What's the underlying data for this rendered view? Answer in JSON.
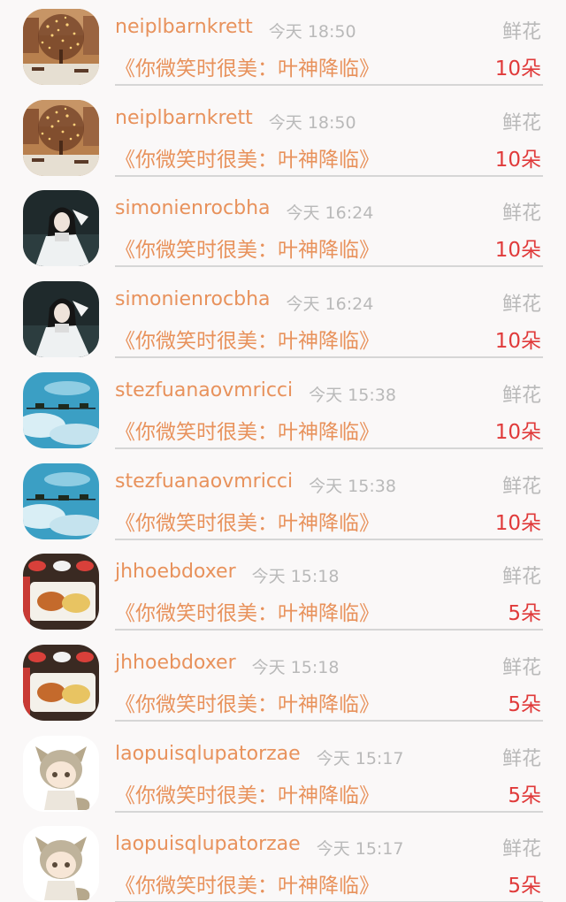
{
  "gift_list": [
    {
      "username": "neiplbarnkrett",
      "time": "今天 18:50",
      "gift_type": "鲜花",
      "title": "《你微笑时很美：叶神降临》",
      "count": "10朵",
      "avatar": "tree-lights"
    },
    {
      "username": "neiplbarnkrett",
      "time": "今天 18:50",
      "gift_type": "鲜花",
      "title": "《你微笑时很美：叶神降临》",
      "count": "10朵",
      "avatar": "tree-lights"
    },
    {
      "username": "simonienrocbha",
      "time": "今天 16:24",
      "gift_type": "鲜花",
      "title": "《你微笑时很美：叶神降临》",
      "count": "10朵",
      "avatar": "doll"
    },
    {
      "username": "simonienrocbha",
      "time": "今天 16:24",
      "gift_type": "鲜花",
      "title": "《你微笑时很美：叶神降临》",
      "count": "10朵",
      "avatar": "doll"
    },
    {
      "username": "stezfuanaovmricci",
      "time": "今天 15:38",
      "gift_type": "鲜花",
      "title": "《你微笑时很美：叶神降临》",
      "count": "10朵",
      "avatar": "sky"
    },
    {
      "username": "stezfuanaovmricci",
      "time": "今天 15:38",
      "gift_type": "鲜花",
      "title": "《你微笑时很美：叶神降临》",
      "count": "10朵",
      "avatar": "sky"
    },
    {
      "username": "jhhoebdoxer",
      "time": "今天 15:18",
      "gift_type": "鲜花",
      "title": "《你微笑时很美：叶神降临》",
      "count": "5朵",
      "avatar": "meal"
    },
    {
      "username": "jhhoebdoxer",
      "time": "今天 15:18",
      "gift_type": "鲜花",
      "title": "《你微笑时很美：叶神降临》",
      "count": "5朵",
      "avatar": "meal"
    },
    {
      "username": "laopuisqlupatorzae",
      "time": "今天 15:17",
      "gift_type": "鲜花",
      "title": "《你微笑时很美：叶神降临》",
      "count": "5朵",
      "avatar": "anime-fox"
    },
    {
      "username": "laopuisqlupatorzae",
      "time": "今天 15:17",
      "gift_type": "鲜花",
      "title": "《你微笑时很美：叶神降临》",
      "count": "5朵",
      "avatar": "anime-fox"
    }
  ],
  "colors": {
    "username": "#e8925c",
    "title": "#e8925c",
    "count": "#e03a3a",
    "muted": "#b9b9b9",
    "divider": "#d6d6d6",
    "background": "#faf8f8"
  }
}
